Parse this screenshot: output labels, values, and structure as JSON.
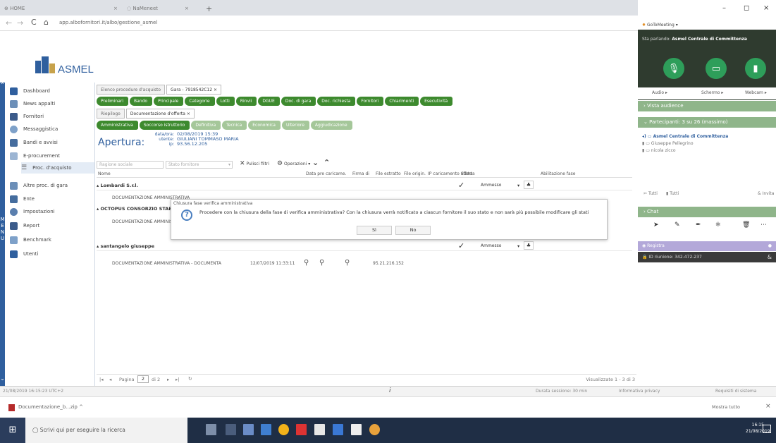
{
  "browser": {
    "tab1": "HOME",
    "tab2": "NaMeneet",
    "url": "app.albofornitori.it/albo/gestione_asmel"
  },
  "brand": {
    "logo_text": "ASMEL"
  },
  "sidebar": {
    "items": [
      {
        "label": "Dashboard"
      },
      {
        "label": "News appalti"
      },
      {
        "label": "Fornitori"
      },
      {
        "label": "Messaggistica"
      },
      {
        "label": "Bandi e avvisi"
      },
      {
        "label": "E-procurement"
      },
      {
        "label": "Proc. d'acquisto"
      },
      {
        "label": "Altre proc. di gara"
      },
      {
        "label": "Ente"
      },
      {
        "label": "Impostazioni"
      },
      {
        "label": "Report"
      },
      {
        "label": "Benchmark"
      },
      {
        "label": "Utenti"
      }
    ],
    "menu_letters": "MENU"
  },
  "tabs_row1": {
    "tab1": "Elenco procedure d'acquisto",
    "tab2": "Gara - 7918542C12",
    "close": "×"
  },
  "pills_row1": [
    "Preliminari",
    "Bando",
    "Principale",
    "Categorie",
    "Lotti",
    "Rinvii",
    "DGUE",
    "Doc. di gara",
    "Doc. richiesta",
    "Fornitori",
    "Chiarimenti",
    "Esecutività"
  ],
  "tabs_row2": {
    "tab1": "Riepilogo",
    "tab2": "Documentazione d'offerta",
    "close": "×"
  },
  "pills_row2": [
    "Amministrativa",
    "Soccorso istruttorio",
    "Definitiva",
    "Tecnica",
    "Economica",
    "Ulteriore",
    "Aggiudicazione"
  ],
  "apertura": {
    "title": "Apertura:",
    "data_label": "data/ora:",
    "data_value": "02/08/2019 15:39",
    "utente_label": "utente:",
    "utente_value": "GIULIANI TOMMASO MARIA",
    "ip_label": "ip:",
    "ip_value": "93.56.12.205"
  },
  "filters": {
    "ragione_placeholder": "Ragione sociale",
    "stato_placeholder": "Stato fornitore",
    "pulisci": "Pulisci filtri",
    "operazioni": "Operazioni"
  },
  "table": {
    "headers": [
      "Nome",
      "Data pre caricame.",
      "Firma di",
      "File estratto",
      "File origin.",
      "IP caricamento offerta",
      "Stato",
      "Abilitazione fase"
    ],
    "rows": [
      {
        "name": "Lombardi S.r.l.",
        "stato": "Ammesso",
        "doc": "DOCUMENTAZIONE AMMINISTRATIVA"
      },
      {
        "name": "OCTOPUS CONSORZIO STABILE",
        "doc": "DOCUMENTAZIONE AMMINISTRATIVA"
      },
      {
        "name": "santangelo giuseppe",
        "stato": "Ammesso",
        "doc": "DOCUMENTAZIONE AMMINISTRATIVA - DOCUMENTA",
        "date": "12/07/2019 11:33:11",
        "ip": "95.21.216.152"
      }
    ]
  },
  "dialog": {
    "title": "Chiusura fase verifica amministrativa",
    "message": "Procedere con la chiusura della fase di verifica amministrativa? Con la chiusura verrà notificato a ciascun fornitore il suo stato e non sarà più possibile modificare gli stati",
    "yes": "Sì",
    "no": "No"
  },
  "pager": {
    "pagina_label": "Pagina",
    "page": "2",
    "of": "di 2",
    "info": "Visualizzate 1 - 3 di 3"
  },
  "status": {
    "datetime": "21/08/2019 16:15:23 UTC+2",
    "info": "i",
    "session": "Durata sessione: 30 min",
    "privacy": "Informativa privacy",
    "requisiti": "Requisiti di sistema"
  },
  "download": {
    "file": "Documentazione_b...zip",
    "show_all": "Mostra tutto"
  },
  "meeting": {
    "app": "GoToMeeting",
    "speaking_label": "Sta parlando:",
    "speaking_name": "Asmel Centrale di Committenza",
    "audio": "Audio",
    "schermo": "Schermo",
    "webcam": "Webcam",
    "audience": "Vista audience",
    "participants": "Partecipanti: 3 su 26 (massimo)",
    "people": [
      "Asmel Centrale di Committenza",
      "Giuseppe Pellegrino",
      "nicola zicco"
    ],
    "tutti1": "Tutti",
    "tutti2": "Tutti",
    "invita": "Invita",
    "chat": "Chat",
    "registra": "Registra",
    "id": "ID riunione: 342-472-237"
  },
  "taskbar": {
    "search": "Scrivi qui per eseguire la ricerca",
    "time": "16:15",
    "date": "21/08/2019"
  },
  "colors": {
    "green": "#3d8a2e",
    "blue": "#2f5f9e",
    "meeting_dark": "#2f3b2f",
    "meeting_green": "#2e9e5a"
  }
}
